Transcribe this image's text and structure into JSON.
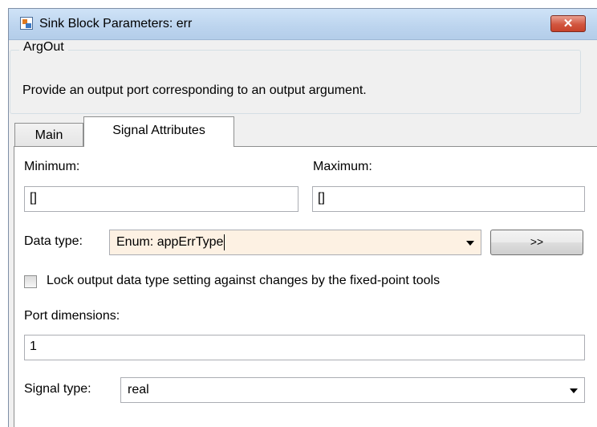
{
  "window": {
    "title": "Sink Block Parameters: err",
    "close_label": "✕"
  },
  "block": {
    "group_title": "ArgOut",
    "description": "Provide an output port corresponding to an output argument."
  },
  "tabs": [
    {
      "label": "Main",
      "active": false
    },
    {
      "label": "Signal Attributes",
      "active": true
    }
  ],
  "params": {
    "minimum_label": "Minimum:",
    "minimum_value": "[]",
    "maximum_label": "Maximum:",
    "maximum_value": "[]",
    "data_type_label": "Data type:",
    "data_type_value": "Enum: appErrType",
    "data_type_assistant_label": ">>",
    "lock_label": "Lock output data type setting against changes by the fixed-point tools",
    "lock_checked": false,
    "port_dimensions_label": "Port dimensions:",
    "port_dimensions_value": "1",
    "signal_type_label": "Signal type:",
    "signal_type_value": "real"
  },
  "colors": {
    "titlebar": "#bcd4ee",
    "close_button": "#c7432b",
    "data_type_highlight": "#fdf1e3"
  }
}
